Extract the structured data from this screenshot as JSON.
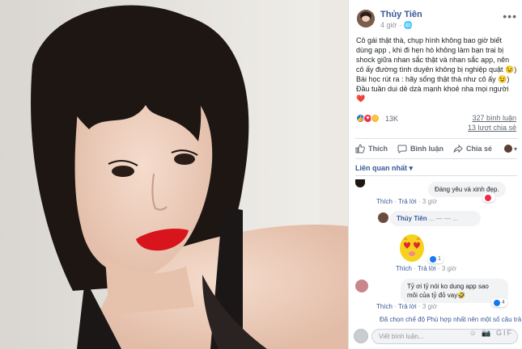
{
  "post": {
    "author": "Thủy Tiên",
    "time": "4 giờ",
    "audience_glyph": "🌐",
    "text_lines": [
      "Cô gái thật thà, chụp hình không bao giờ biết dùng app , khi đi hẹn hò không làm bạn trai bị shock giữa nhan sắc thật và nhan sắc app, nên cô ấy đường tình duyên không bị nghiệp quật 😉)",
      "Bài học rút ra : hãy sống thật thà như cô ấy 😉)",
      "Đầu tuần dui dẻ dzà mạnh khoẻ nha mọi người ❤️"
    ]
  },
  "reactions": {
    "count": "13K",
    "comments": "327 bình luận",
    "shares": "13 lượt chia sẻ",
    "icons": [
      "like-icon",
      "love-icon",
      "haha-icon"
    ]
  },
  "actions": {
    "like": "Thích",
    "comment": "Bình luận",
    "share": "Chia sẻ"
  },
  "filter": {
    "label": "Liên quan nhất ▾"
  },
  "comments": [
    {
      "text": "Đáng yêu và xinh đẹp.",
      "like": "Thích",
      "reply": "Trả lời",
      "time": "3 giờ",
      "reaction": "love-icon"
    },
    {
      "author": "Thủy Tiên",
      "author_suffix": "... — — ...",
      "like": "Thích",
      "reply": "Trả lời",
      "time": "3 giờ",
      "reaction_count": "1"
    },
    {
      "text_lines": [
        "Tỷ ơi tỷ nói ko dung app sao",
        "môi của tỷ đỏ vay🤣"
      ],
      "like": "Thích",
      "reply": "Trả lời",
      "time": "3 giờ",
      "reaction_count": "4"
    }
  ],
  "truncated_comment": "Đã chọn chế độ Phù hợp nhất nên một số câu trả",
  "composer": {
    "placeholder": "Viết bình luận...",
    "tools": "☺ 📷 GIF"
  },
  "colors": {
    "link": "#385898",
    "like_blue": "#1877f2",
    "love_red": "#f02849",
    "lip_red": "#d8141c"
  }
}
